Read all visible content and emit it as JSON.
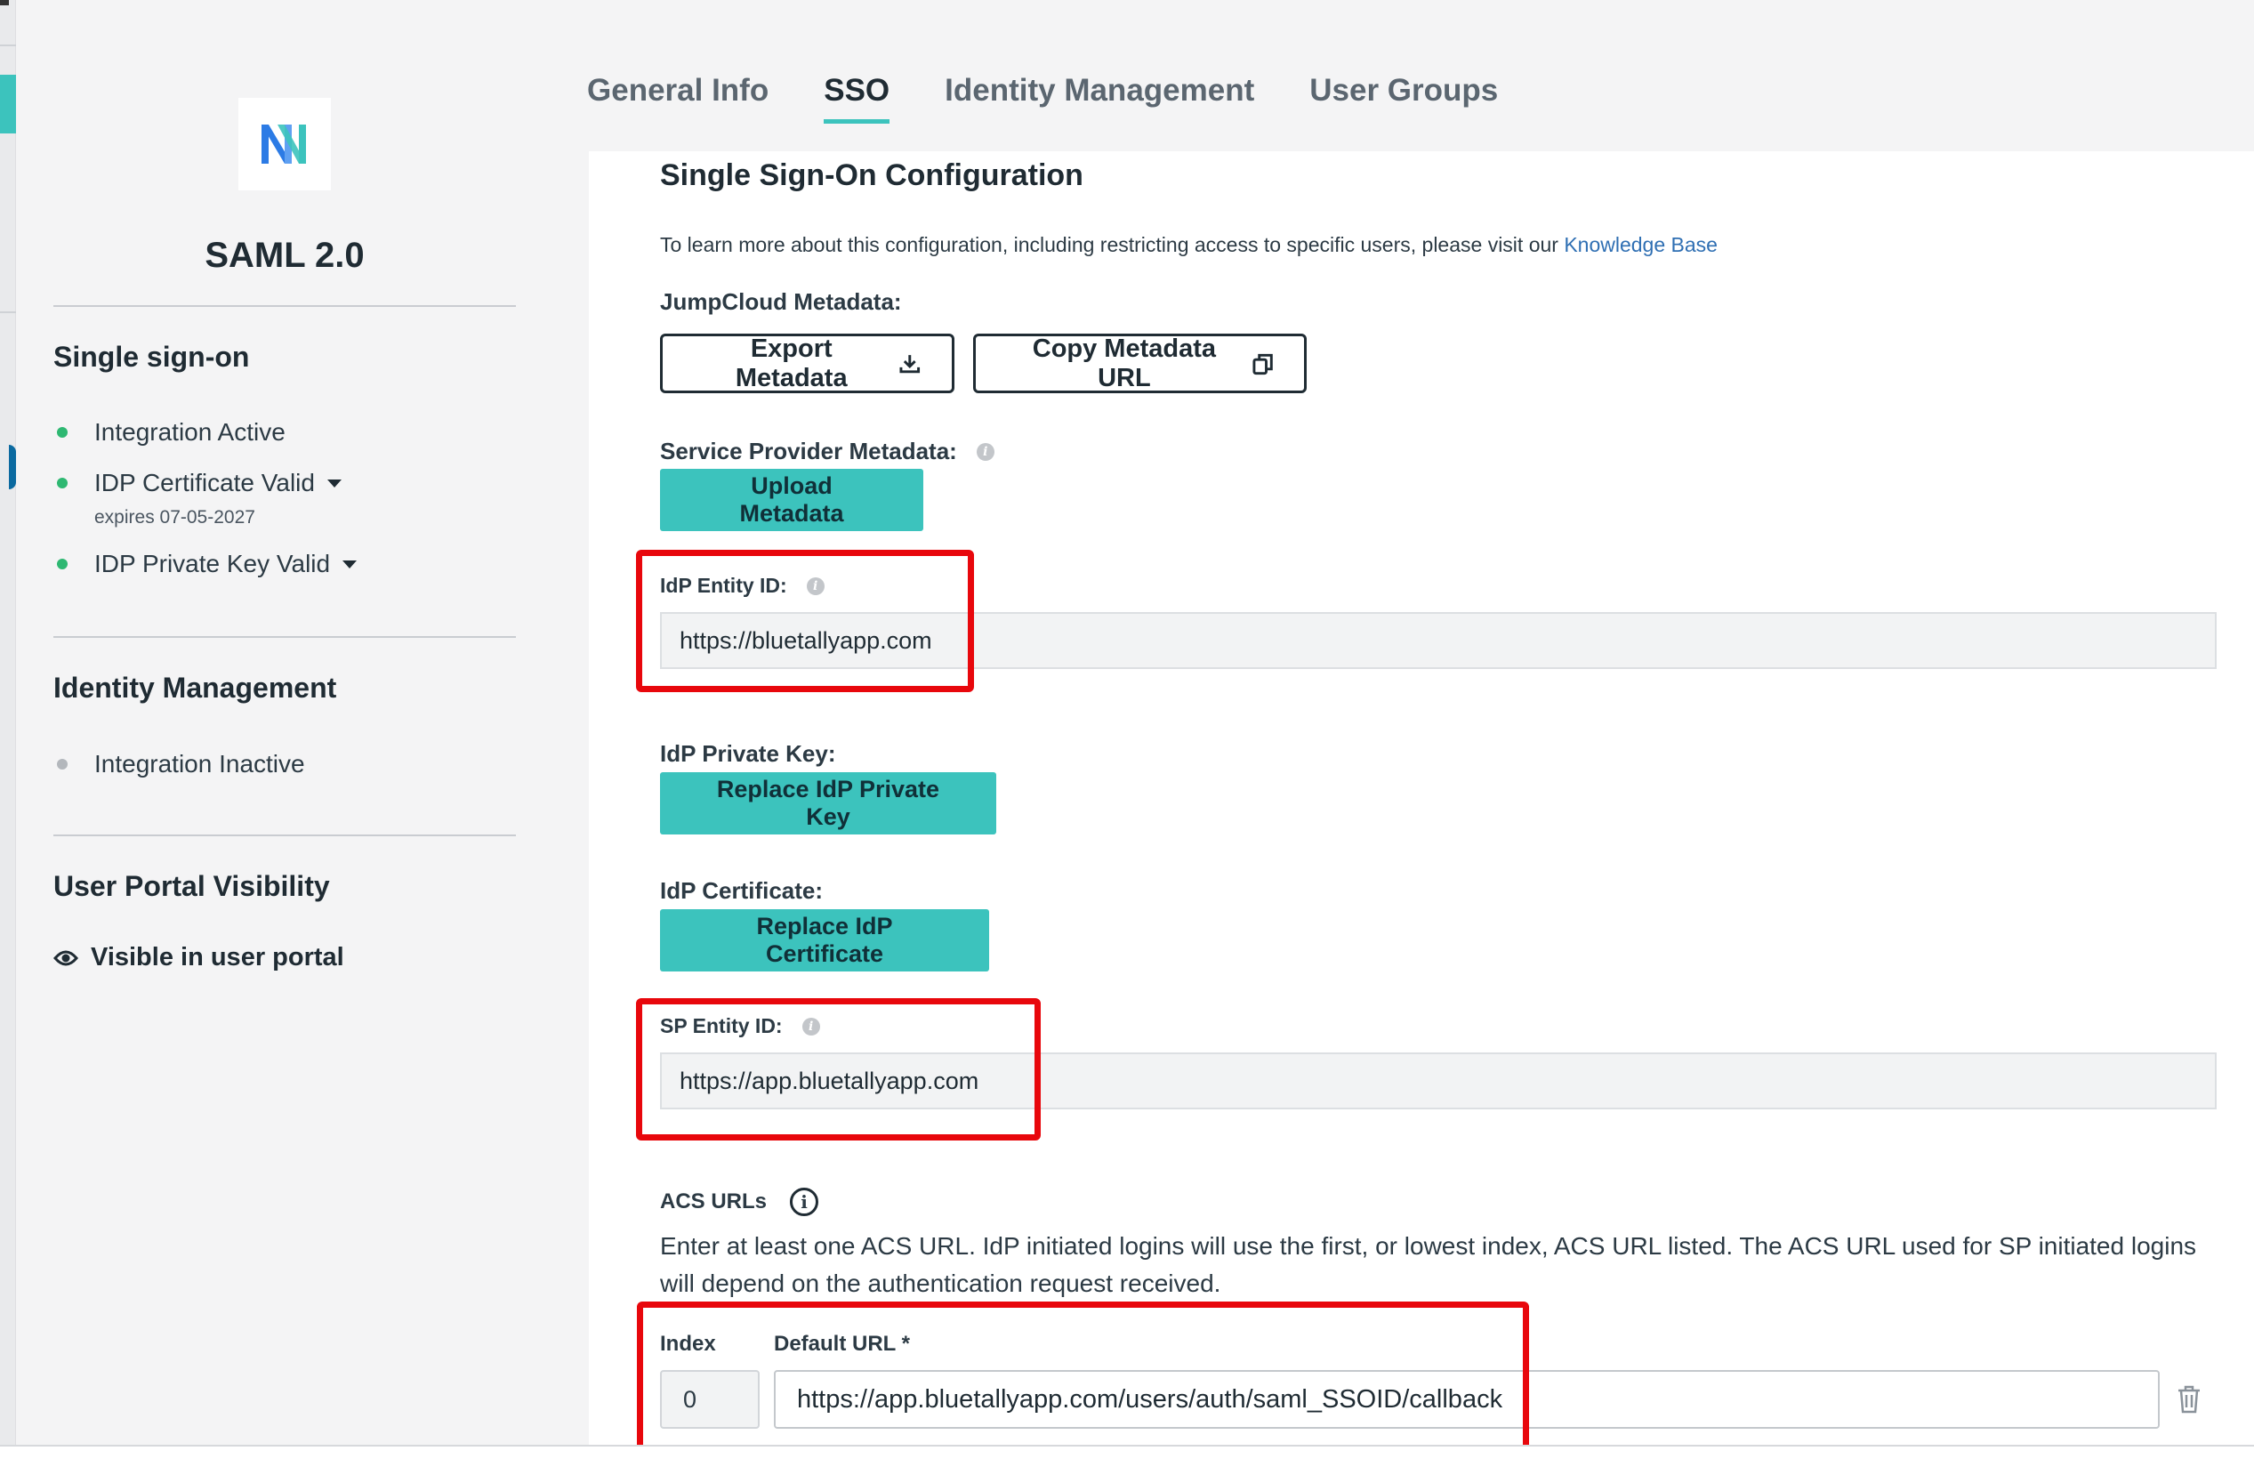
{
  "app": {
    "name": "SAML 2.0",
    "logo_icon": "app-logo-icon"
  },
  "tabs": [
    {
      "label": "General Info",
      "active": false
    },
    {
      "label": "SSO",
      "active": true
    },
    {
      "label": "Identity Management",
      "active": false
    },
    {
      "label": "User Groups",
      "active": false
    }
  ],
  "sidebar": {
    "sso_title": "Single sign-on",
    "sso_status": [
      {
        "label": "Integration Active",
        "status": "green"
      },
      {
        "label": "IDP Certificate Valid",
        "status": "green",
        "note": "expires 07-05-2027"
      },
      {
        "label": "IDP Private Key Valid",
        "status": "green"
      }
    ],
    "idm_title": "Identity Management",
    "idm_status": {
      "label": "Integration Inactive",
      "status": "gray"
    },
    "portal_title": "User Portal Visibility",
    "portal_status": "Visible in user portal"
  },
  "config": {
    "title": "Single Sign-On Configuration",
    "info_text": "To learn more about this configuration, including restricting access to specific users, please visit our ",
    "info_link": "Knowledge Base",
    "jc_metadata_label": "JumpCloud Metadata:",
    "export_button": "Export Metadata",
    "copy_button": "Copy Metadata URL",
    "sp_metadata_label": "Service Provider Metadata:",
    "upload_button": "Upload Metadata",
    "idp_entity_label": "IdP Entity ID:",
    "idp_entity_value": "https://bluetallyapp.com",
    "idp_private_key_label": "IdP Private Key:",
    "replace_key_button": "Replace IdP Private Key",
    "idp_cert_label": "IdP Certificate:",
    "replace_cert_button": "Replace IdP Certificate",
    "sp_entity_label": "SP Entity ID:",
    "sp_entity_value": "https://app.bluetallyapp.com",
    "acs_title": "ACS URLs",
    "acs_description": "Enter at least one ACS URL. IdP initiated logins will use the first, or lowest index, ACS URL listed. The ACS URL used for SP initiated logins will depend on the authentication request received.",
    "index_label": "Index",
    "default_url_label": "Default URL *",
    "index_value": "0",
    "default_url_value": "https://app.bluetallyapp.com/users/auth/saml_SSOID/callback"
  },
  "colors": {
    "accent": "#3cc3bd",
    "status_green": "#2eb872",
    "highlight": "#e8070c",
    "link": "#2f6fb3"
  }
}
